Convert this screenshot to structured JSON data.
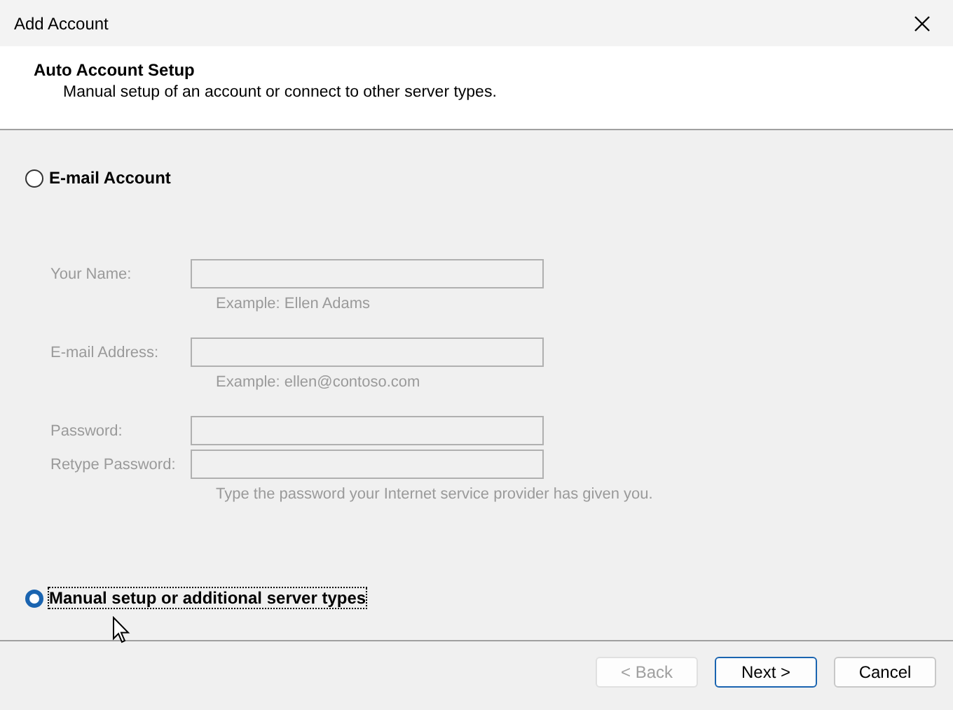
{
  "window": {
    "title": "Add Account"
  },
  "header": {
    "title": "Auto Account Setup",
    "subtitle": "Manual setup of an account or connect to other server types."
  },
  "options": [
    {
      "label": "E-mail Account",
      "selected": false
    },
    {
      "label": "Manual setup or additional server types",
      "selected": true
    }
  ],
  "form": {
    "disabled": true,
    "fields": [
      {
        "label": "Your Name:",
        "hint": "Example: Ellen Adams"
      },
      {
        "label": "E-mail Address:",
        "hint": "Example: ellen@contoso.com"
      },
      {
        "label": "Password:"
      },
      {
        "label": "Retype Password:",
        "hint": "Type the password your Internet service provider has given you."
      }
    ]
  },
  "buttons": [
    {
      "label": "< Back",
      "disabled": true,
      "default": false
    },
    {
      "label": "Next >",
      "disabled": false,
      "default": true
    },
    {
      "label": "Cancel",
      "disabled": false,
      "default": false
    }
  ]
}
